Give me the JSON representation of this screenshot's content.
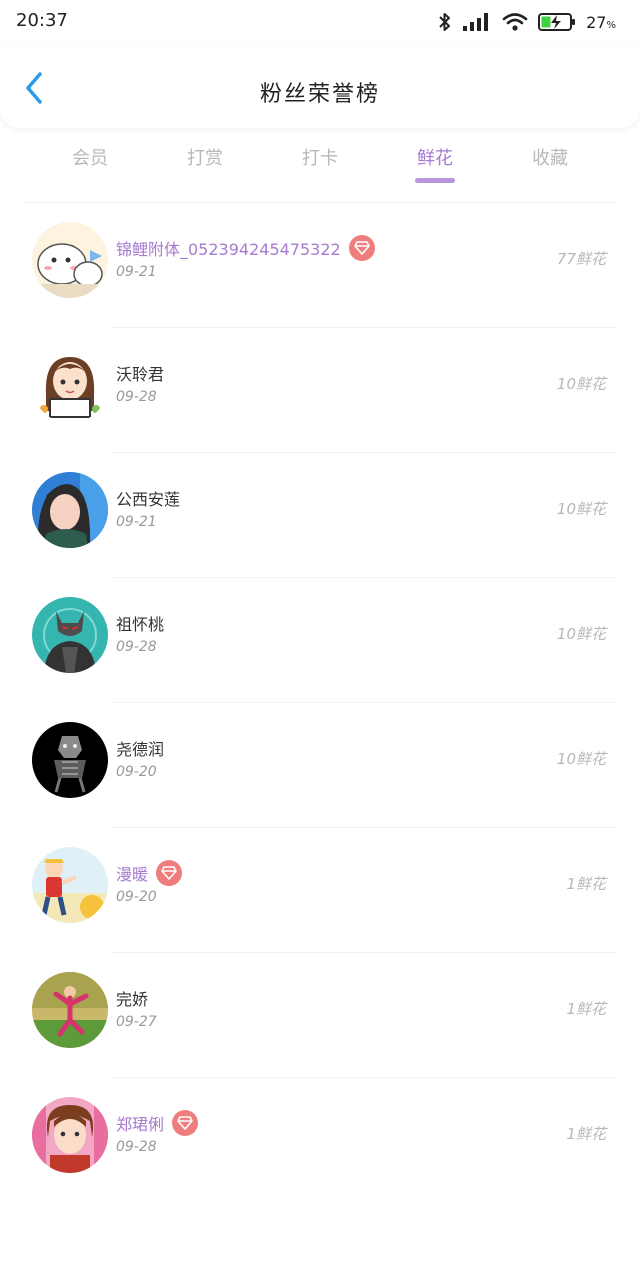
{
  "status_bar": {
    "time": "20:37",
    "battery": "27",
    "battery_unit": "%",
    "icons": [
      "bluetooth-icon",
      "signal-icon",
      "wifi-icon",
      "battery-charging-icon"
    ]
  },
  "header": {
    "title": "粉丝荣誉榜",
    "back_icon": "chevron-left-icon"
  },
  "colors": {
    "accent": "#a67bd0",
    "indicator": "#b996dd",
    "back": "#2e9be6",
    "vip_badge": "#f07d7d",
    "muted": "#b8b8b8"
  },
  "tabs": [
    {
      "label": "会员",
      "active": false
    },
    {
      "label": "打赏",
      "active": false
    },
    {
      "label": "打卡",
      "active": false
    },
    {
      "label": "鲜花",
      "active": true
    },
    {
      "label": "收藏",
      "active": false
    }
  ],
  "rows": [
    {
      "name": "锦鲤附体_052394245475322",
      "date": "09-21",
      "count": "77鲜花",
      "vip": true
    },
    {
      "name": "沃聆君",
      "date": "09-28",
      "count": "10鲜花",
      "vip": false
    },
    {
      "name": "公西安莲",
      "date": "09-21",
      "count": "10鲜花",
      "vip": false
    },
    {
      "name": "祖怀桃",
      "date": "09-28",
      "count": "10鲜花",
      "vip": false
    },
    {
      "name": "尧德润",
      "date": "09-20",
      "count": "10鲜花",
      "vip": false
    },
    {
      "name": "漫暖",
      "date": "09-20",
      "count": "1鲜花",
      "vip": true
    },
    {
      "name": "完娇",
      "date": "09-27",
      "count": "1鲜花",
      "vip": false
    },
    {
      "name": "郑珺俐",
      "date": "09-28",
      "count": "1鲜花",
      "vip": true
    }
  ]
}
